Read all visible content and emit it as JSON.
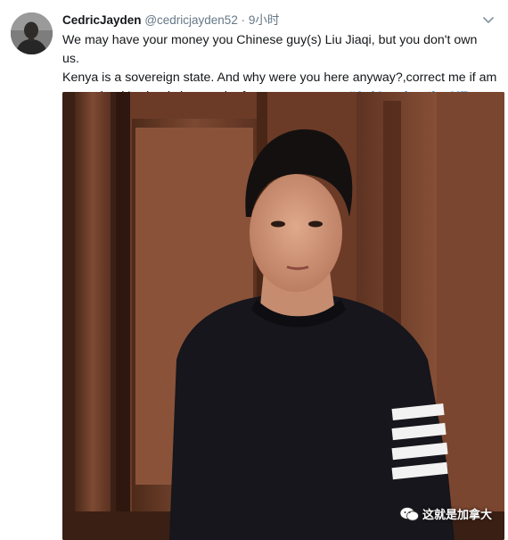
{
  "tweet": {
    "author": {
      "display_name": "CedricJayden",
      "handle": "@cedricjayden52"
    },
    "separator": "·",
    "timestamp": "9小时",
    "text_lines": [
      "We may have your money you Chinese guy(s) Liu Jiaqi, but you don't own us.",
      "Kenya is a sovereign state. And why were you here anyway?,correct me if am",
      "wrong but it's clearly in search of greener pastures "
    ],
    "hashtag": "#AskImmigrationKE"
  },
  "watermark": {
    "text": "这就是加拿大",
    "icon": "wechat-icon"
  },
  "colors": {
    "text": "#14171a",
    "secondary": "#657786",
    "hashtag": "#1b95e0",
    "wood": "#7a4530",
    "sweater": "#14141a"
  }
}
